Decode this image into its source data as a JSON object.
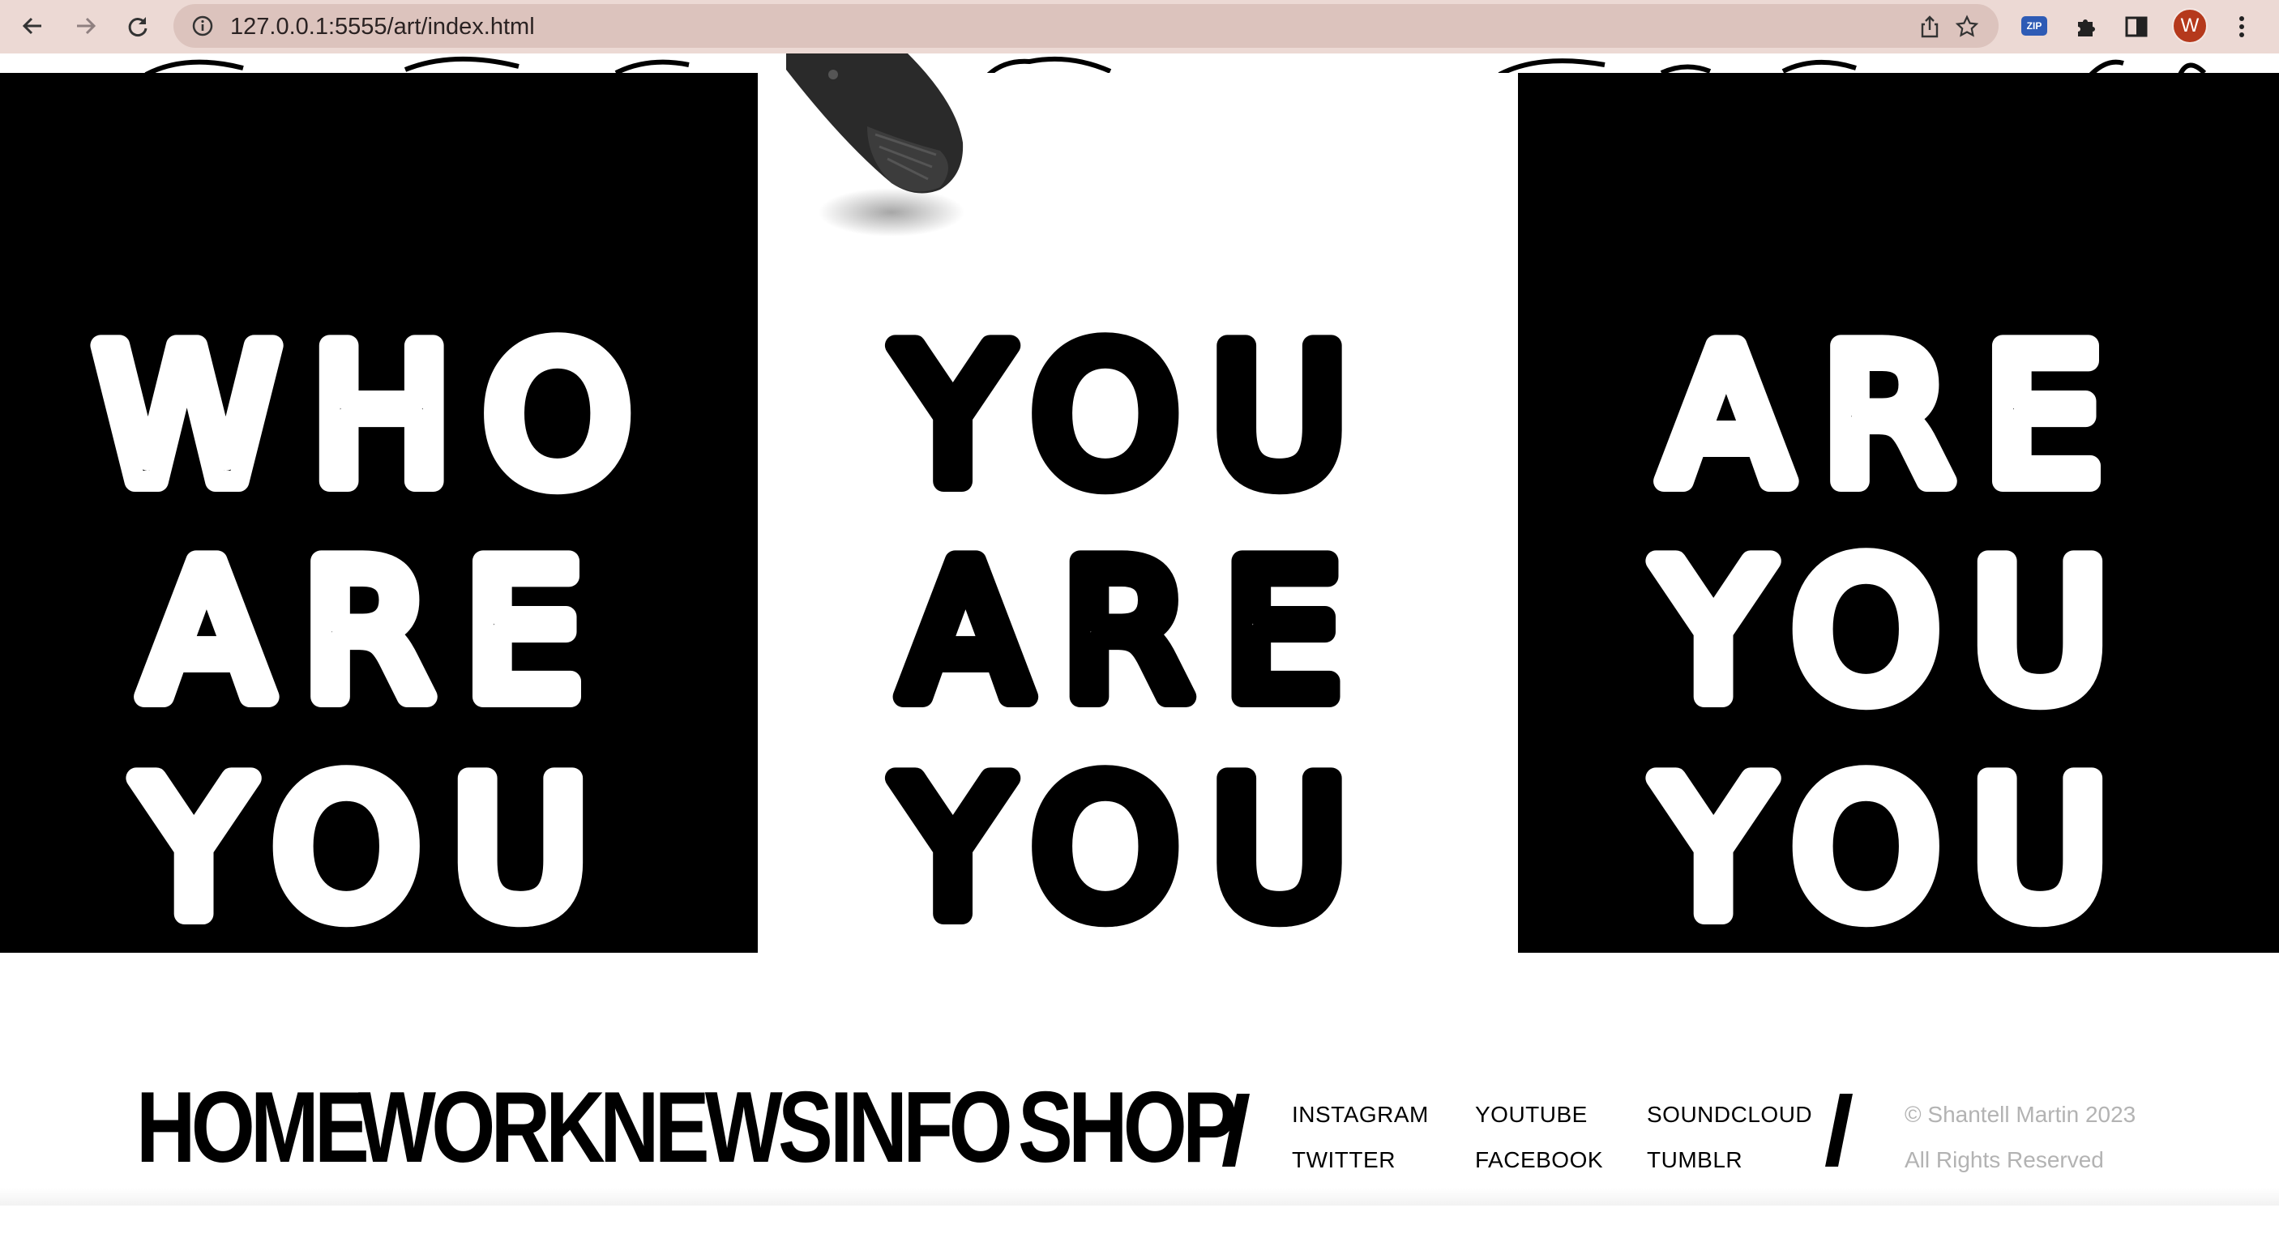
{
  "browser": {
    "url": "127.0.0.1:5555/art/index.html",
    "profile_initial": "W",
    "extension_badge": "ZIP",
    "icons": [
      "back-icon",
      "forward-icon",
      "reload-icon",
      "site-info-icon",
      "share-icon",
      "bookmark-star-icon",
      "extensions-puzzle-icon",
      "side-panel-icon",
      "more-menu-icon"
    ]
  },
  "artwork": {
    "panels": [
      {
        "lines": [
          "WHO",
          "ARE",
          "YOU"
        ],
        "background": "#000000",
        "ink": "#ffffff"
      },
      {
        "lines": [
          "YOU",
          "ARE",
          "YOU"
        ],
        "background": "#ffffff",
        "ink": "#000000"
      },
      {
        "lines": [
          "ARE",
          "YOU",
          "YOU"
        ],
        "background": "#000000",
        "ink": "#ffffff"
      }
    ]
  },
  "footer": {
    "nav": [
      "HOME",
      "WORK",
      "NEWS",
      "INFO",
      "SHOP"
    ],
    "social": [
      [
        "INSTAGRAM",
        "TWITTER"
      ],
      [
        "YOUTUBE",
        "FACEBOOK"
      ],
      [
        "SOUNDCLOUD",
        "TUMBLR"
      ]
    ],
    "copyright": "© Shantell Martin 2023",
    "rights": "All Rights Reserved"
  }
}
